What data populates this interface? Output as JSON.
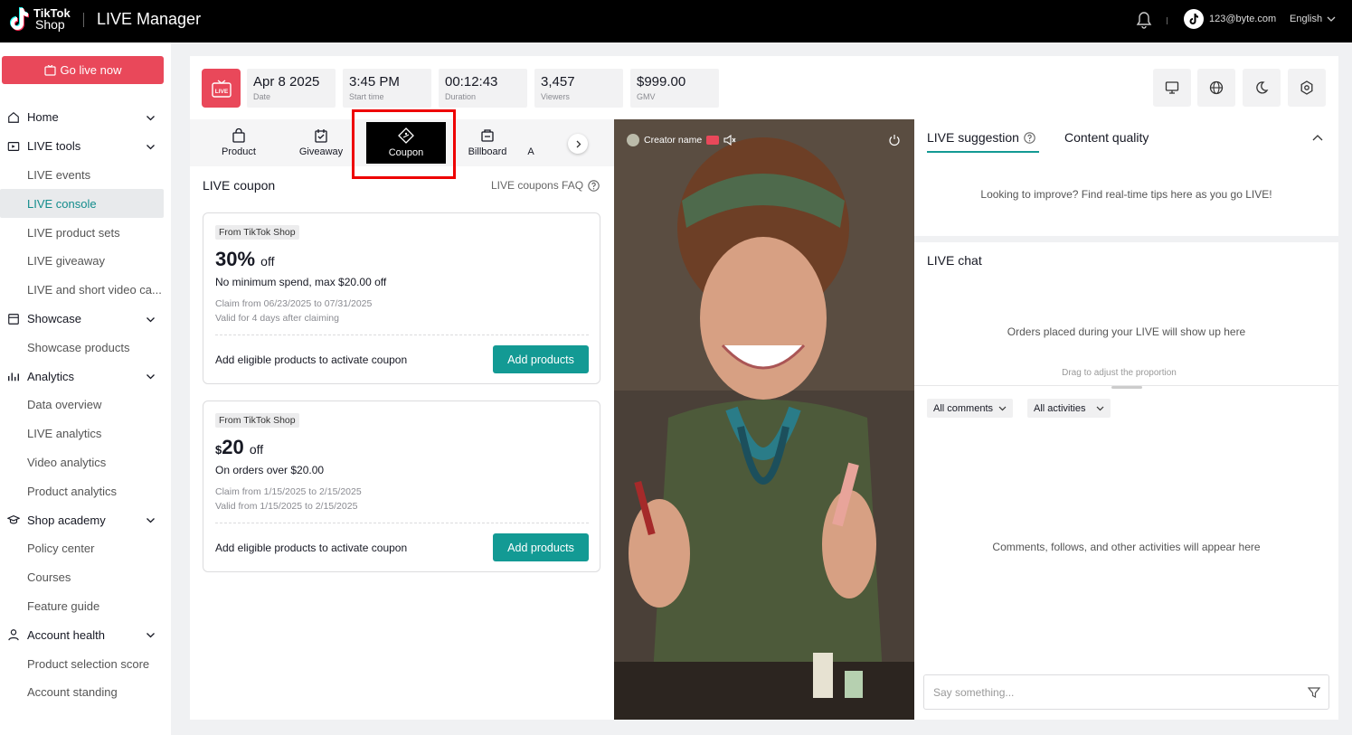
{
  "header": {
    "logo_line1": "TikTok",
    "logo_line2": "Shop",
    "app_title": "LIVE Manager",
    "user_email": "123@byte.com",
    "language": "English"
  },
  "sidebar": {
    "go_live_label": "Go live now",
    "items": [
      {
        "label": "Home",
        "type": "group",
        "icon": "home-icon"
      },
      {
        "label": "LIVE tools",
        "type": "group",
        "icon": "live-tools-icon"
      },
      {
        "label": "LIVE events",
        "type": "sub"
      },
      {
        "label": "LIVE console",
        "type": "sub",
        "active": true
      },
      {
        "label": "LIVE product sets",
        "type": "sub"
      },
      {
        "label": "LIVE giveaway",
        "type": "sub"
      },
      {
        "label": "LIVE and short video ca...",
        "type": "sub"
      },
      {
        "label": "Showcase",
        "type": "group",
        "icon": "showcase-icon"
      },
      {
        "label": "Showcase products",
        "type": "sub"
      },
      {
        "label": "Analytics",
        "type": "group",
        "icon": "analytics-icon"
      },
      {
        "label": "Data overview",
        "type": "sub"
      },
      {
        "label": "LIVE analytics",
        "type": "sub"
      },
      {
        "label": "Video analytics",
        "type": "sub"
      },
      {
        "label": "Product analytics",
        "type": "sub"
      },
      {
        "label": "Shop academy",
        "type": "group",
        "icon": "academy-icon"
      },
      {
        "label": "Policy center",
        "type": "sub"
      },
      {
        "label": "Courses",
        "type": "sub"
      },
      {
        "label": "Feature guide",
        "type": "sub"
      },
      {
        "label": "Account health",
        "type": "group",
        "icon": "account-icon"
      },
      {
        "label": "Product selection score",
        "type": "sub"
      },
      {
        "label": "Account standing",
        "type": "sub"
      }
    ]
  },
  "stats": {
    "live_badge": "LIVE",
    "items": [
      {
        "value": "Apr 8 2025",
        "label": "Date"
      },
      {
        "value": "3:45 PM",
        "label": "Start time"
      },
      {
        "value": "00:12:43",
        "label": "Duration"
      },
      {
        "value": "3,457",
        "label": "Viewers"
      },
      {
        "value": "$999.00",
        "label": "GMV"
      }
    ]
  },
  "tools": {
    "tabs": [
      {
        "label": "Product",
        "icon": "bag-icon"
      },
      {
        "label": "Giveaway",
        "icon": "giveaway-icon"
      },
      {
        "label": "Coupon",
        "icon": "coupon-icon",
        "active": true
      },
      {
        "label": "Billboard",
        "icon": "billboard-icon"
      },
      {
        "label": "A",
        "icon": ""
      }
    ]
  },
  "coupons": {
    "title": "LIVE coupon",
    "faq": "LIVE coupons FAQ",
    "cards": [
      {
        "badge": "From TikTok Shop",
        "amount_prefix": "",
        "amount": "30%",
        "off": "off",
        "description": "No minimum spend, max $20.00 off",
        "claim": "Claim from 06/23/2025 to 07/31/2025",
        "valid": "Valid for 4 days after claiming",
        "footer": "Add eligible products to activate coupon",
        "button": "Add products"
      },
      {
        "badge": "From TikTok Shop",
        "amount_prefix": "$",
        "amount": "20",
        "off": "off",
        "description": "On orders over $20.00",
        "claim": "Claim from 1/15/2025 to 2/15/2025",
        "valid": "Valid from 1/15/2025 to 2/15/2025",
        "footer": "Add eligible products to activate coupon",
        "button": "Add products"
      }
    ]
  },
  "video": {
    "creator_name": "Creator name"
  },
  "suggestions": {
    "tab_active": "LIVE suggestion",
    "tab_other": "Content quality",
    "text": "Looking to improve? Find real-time tips here as you go LIVE!"
  },
  "chat": {
    "title": "LIVE chat",
    "orders_text": "Orders placed during your LIVE will show up here",
    "drag_text": "Drag to adjust the proportion",
    "filter_comments": "All comments",
    "filter_activities": "All activities",
    "activities_text": "Comments, follows, and other activities will appear here",
    "input_placeholder": "Say something..."
  },
  "colors": {
    "brand_red": "#e9485a",
    "accent_teal": "#139a94",
    "active_text": "#138c8c",
    "highlight_box": "#e00000"
  }
}
